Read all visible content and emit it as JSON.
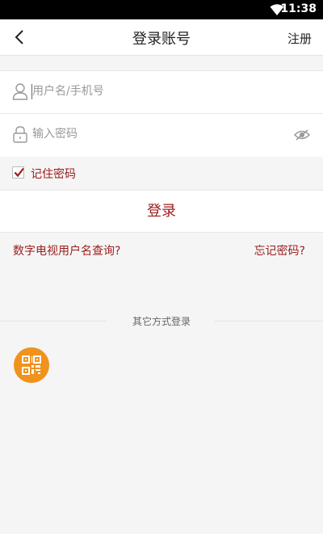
{
  "status_bar": {
    "time": "11:38"
  },
  "header": {
    "title": "登录账号",
    "register_label": "注册"
  },
  "form": {
    "username": {
      "placeholder": "用户名/手机号",
      "value": ""
    },
    "password": {
      "placeholder": "输入密码",
      "value": ""
    }
  },
  "remember": {
    "label": "记住密码",
    "checked": true
  },
  "login_button": {
    "label": "登录"
  },
  "links": {
    "query_username": "数字电视用户名查询?",
    "forgot_password": "忘记密码?"
  },
  "other_login": {
    "divider_text": "其它方式登录",
    "methods": [
      {
        "icon": "qr-code-icon",
        "color": "#f0921e"
      }
    ]
  },
  "colors": {
    "accent": "#9b1c1c",
    "qr_orange": "#f0921e"
  }
}
